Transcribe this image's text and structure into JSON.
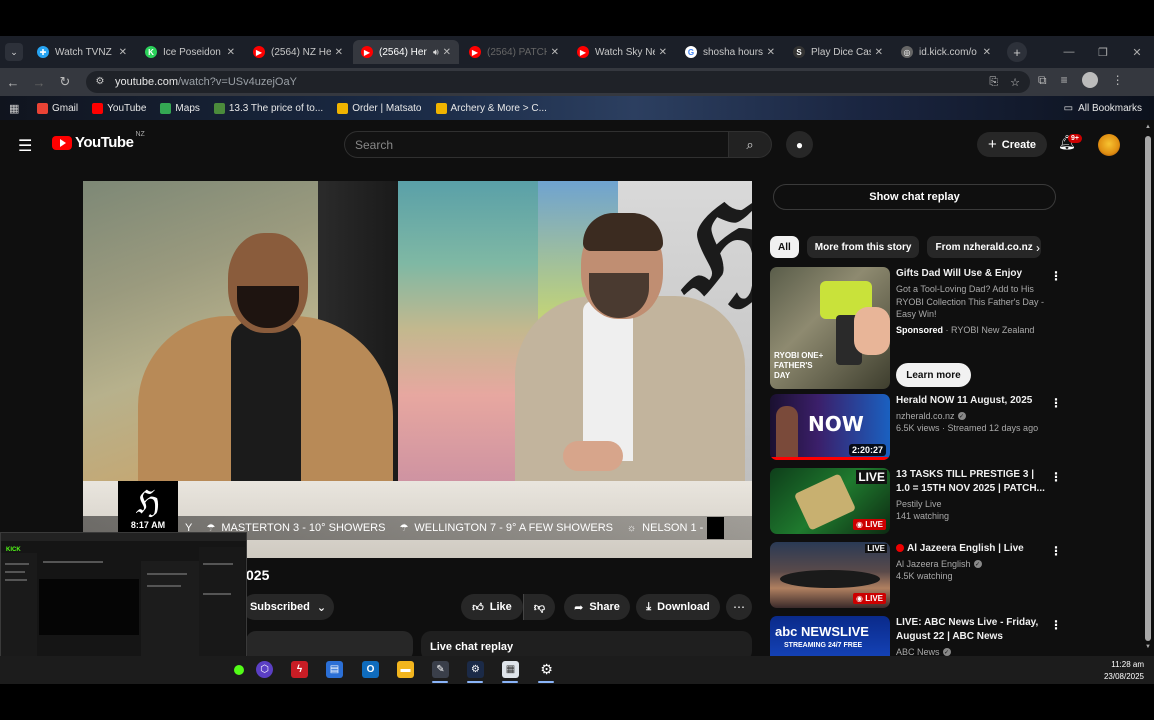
{
  "browser": {
    "tabs": [
      {
        "label": "Watch TVNZ",
        "favicon_color": "#27a4f2",
        "favicon_glyph": "✚",
        "active": false,
        "dim": false
      },
      {
        "label": "Ice Poseidon",
        "favicon_color": "#2bd15a",
        "favicon_glyph": "K",
        "active": false,
        "dim": false
      },
      {
        "label": "(2564) NZ Her",
        "favicon_color": "#ff0000",
        "favicon_glyph": "▶",
        "active": false,
        "dim": false
      },
      {
        "label": "(2564) Her",
        "favicon_color": "#ff0000",
        "favicon_glyph": "▶",
        "active": true,
        "dim": false
      },
      {
        "label": "(2564) PATCH",
        "favicon_color": "#ff0000",
        "favicon_glyph": "▶",
        "active": false,
        "dim": true
      },
      {
        "label": "Watch Sky Ne",
        "favicon_color": "#ff0000",
        "favicon_glyph": "▶",
        "active": false,
        "dim": false
      },
      {
        "label": "shosha hours",
        "favicon_color": "#ffffff",
        "favicon_glyph": "G",
        "active": false,
        "dim": false
      },
      {
        "label": "Play Dice Cas",
        "favicon_color": "#333333",
        "favicon_glyph": "S",
        "active": false,
        "dim": false
      },
      {
        "label": "id.kick.com/o",
        "favicon_color": "#666666",
        "favicon_glyph": "◎",
        "active": false,
        "dim": false
      }
    ],
    "url_host": "youtube.com",
    "url_path": "/watch?v=USv4uzejOaY",
    "bookmarks": [
      {
        "label": "Gmail",
        "icon": "gmail-icon",
        "color": "#ea4335"
      },
      {
        "label": "YouTube",
        "icon": "youtube-icon",
        "color": "#ff0000"
      },
      {
        "label": "Maps",
        "icon": "maps-icon",
        "color": "#34a853"
      },
      {
        "label": "13.3 The price of to...",
        "icon": "bookmark-site-icon",
        "color": "#4b8b3b"
      },
      {
        "label": "Order | Matsato",
        "icon": "folder-icon",
        "color": "#f0b400"
      },
      {
        "label": "Archery & More > C...",
        "icon": "archery-icon",
        "color": "#f0b400"
      }
    ],
    "all_bookmarks": "All Bookmarks"
  },
  "youtube": {
    "logo_text": "YouTube",
    "country": "NZ",
    "search_placeholder": "Search",
    "create_label": "Create",
    "notif_badge": "9+",
    "video_title_fragment": "025",
    "subscribed_label": "Subscribed",
    "like_label": "Like",
    "share_label": "Share",
    "download_label": "Download",
    "live_chat_replay": "Live chat replay",
    "show_chat_replay": "Show chat replay",
    "overlay_time": "8:17 AM",
    "ticker": [
      {
        "icon": "",
        "text": "Y"
      },
      {
        "icon": "☂",
        "text": "MASTERTON 3 - 10° SHOWERS"
      },
      {
        "icon": "☂",
        "text": "WELLINGTON 7 - 9° A FEW SHOWERS"
      },
      {
        "icon": "☼",
        "text": "NELSON 1 -"
      }
    ],
    "chips": [
      "All",
      "More from this story",
      "From nzherald.co.nz"
    ]
  },
  "recommendations": [
    {
      "title": "Gifts Dad Will Use & Enjoy",
      "description": "Got a Tool-Loving Dad? Add to His RYOBI Collection This Father's Day - Easy Win!",
      "sponsored": "Sponsored",
      "channel": "RYOBI New Zealand",
      "cta": "Learn more",
      "thumb_text": "RYOBI ONE+ FATHER'S DAY"
    },
    {
      "title": "Herald NOW 11 August, 2025",
      "channel": "nzherald.co.nz",
      "stats": "6.5K views · Streamed 12 days ago",
      "duration": "2:20:27",
      "thumb_text": "NOW"
    },
    {
      "title": "13 TASKS TILL PRESTIGE 3 | 1.0 = 15TH NOV 2025 | PATCH...",
      "channel": "Pestily Live",
      "stats": "141 watching",
      "live": "LIVE",
      "thumb_text": "LIVE"
    },
    {
      "title": "Al Jazeera English | Live",
      "channel": "Al Jazeera English",
      "stats": "4.5K watching",
      "live": "LIVE",
      "thumb_text": "LIVE"
    },
    {
      "title": "LIVE: ABC News Live - Friday, August 22 | ABC News",
      "channel": "ABC News",
      "thumb_text": "abc NEWSLIVE",
      "thumb_sub": "STREAMING 24/7 FREE"
    }
  ],
  "taskbar": {
    "time": "11:28 am",
    "date": "23/08/2025"
  }
}
